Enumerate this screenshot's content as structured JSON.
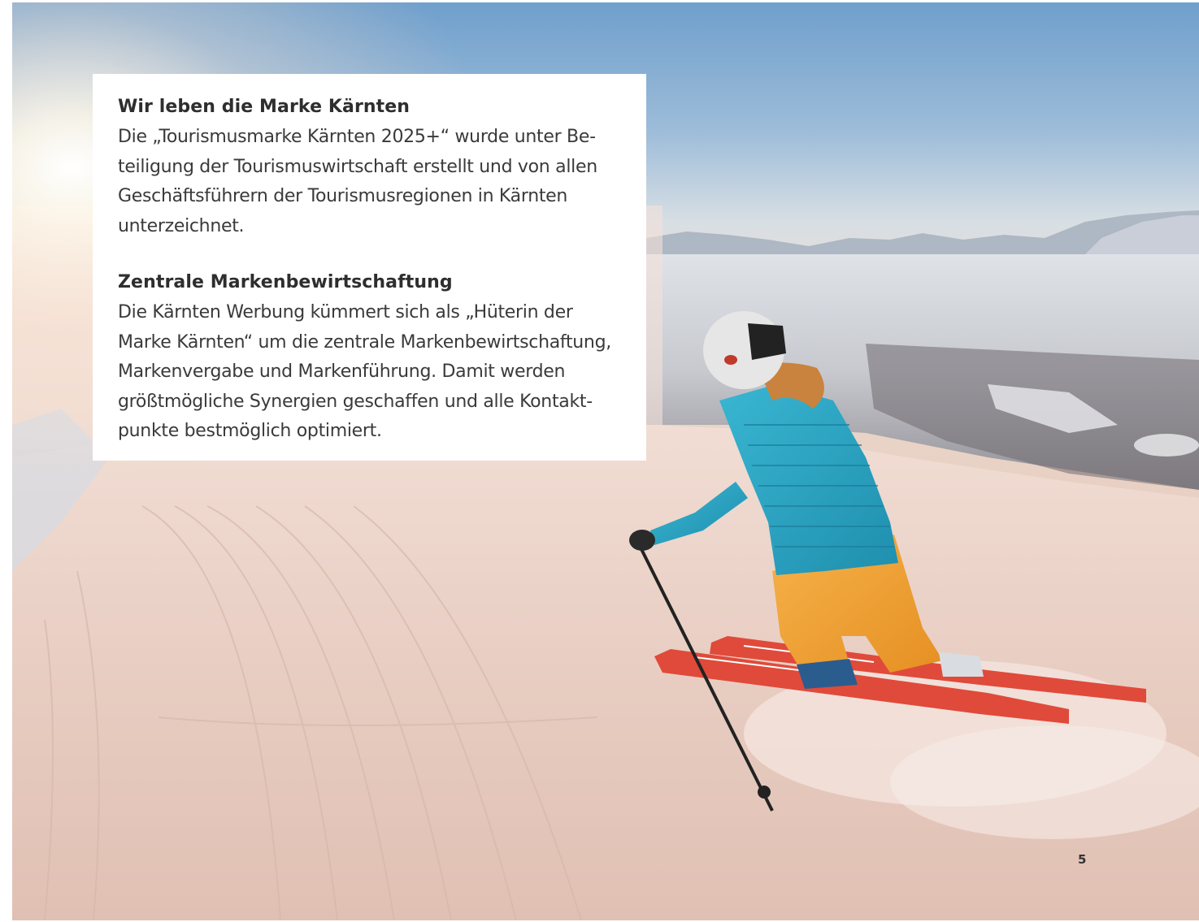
{
  "section1": {
    "heading": "Wir leben die Marke Kärnten",
    "lines": [
      "Die „Tourismusmarke Kärnten 2025+“ wurde unter Be-",
      "teiligung der Tourismuswirtschaft erstellt und von allen",
      "Geschäftsführern der Tourismusregionen in Kärnten",
      "unterzeichnet."
    ]
  },
  "section2": {
    "heading": "Zentrale Markenbewirtschaftung",
    "lines": [
      "Die Kärnten Werbung kümmert sich als „Hüterin der",
      "Marke Kärnten“ um die zentrale Markenbewirtschaftung,",
      "Markenvergabe und Markenführung. Damit werden",
      "größtmögliche Synergien geschaffen und alle Kontakt-",
      "punkte bestmöglich optimiert."
    ]
  },
  "page_number": "5",
  "colors": {
    "sky_top": "#6f9fcc",
    "snow": "#e6c9bd",
    "jacket": "#2aa7c4",
    "pants": "#f0a330",
    "skis": "#e04a3a"
  }
}
